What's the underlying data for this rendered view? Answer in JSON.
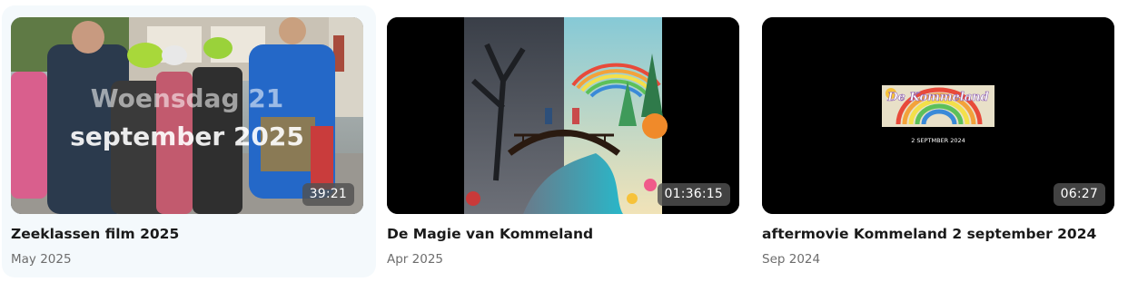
{
  "videos": [
    {
      "overlay_line1": "Woensdag 21",
      "overlay_line2": "september 2025",
      "duration": "39:21",
      "title": "Zeeklassen film 2025",
      "date": "May 2025",
      "thumbnail": "photo-children-with-helmets"
    },
    {
      "duration": "01:36:15",
      "title": "De Magie van Kommeland",
      "date": "Apr 2025",
      "thumbnail": "illustration-bridge-dark-and-rainbow-world"
    },
    {
      "thumb_logo": "De Kommeland",
      "thumb_caption": "2 SEPTMBER 2024",
      "duration": "06:27",
      "title": "aftermovie Kommeland 2 september 2024",
      "date": "Sep 2024",
      "thumbnail": "black-frame-with-rainbow-logo"
    }
  ]
}
